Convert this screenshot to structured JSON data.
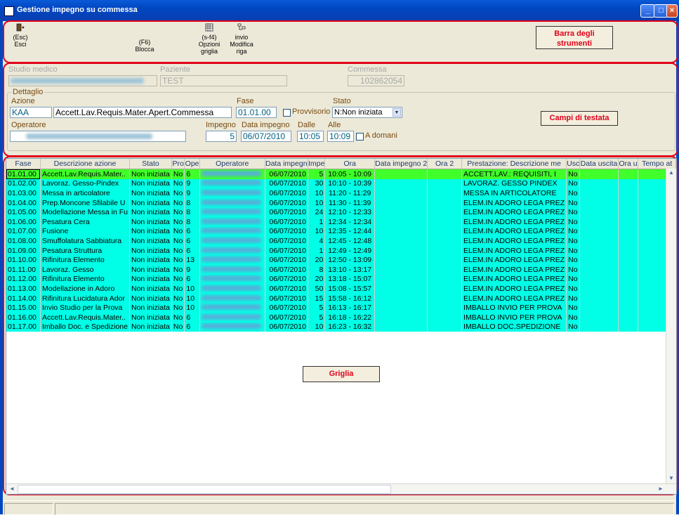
{
  "window": {
    "title": "Gestione impegno su commessa"
  },
  "toolbar": {
    "buttons": [
      {
        "line1": "(Esc)",
        "line2": "Esci",
        "icon": "exit-door-icon"
      },
      {
        "line1": "(F6)",
        "line2": "Blocca"
      },
      {
        "line1": "(s-f4)",
        "line2": "Opzioni",
        "line3": "griglia",
        "icon": "grid-options-icon"
      },
      {
        "line1": "invio",
        "line2": "Modifica",
        "line3": "riga",
        "icon": "edit-row-icon"
      }
    ]
  },
  "callouts": {
    "toolbar": "Barra degli strumenti",
    "header": "Campi di testata",
    "grid": "Griglia"
  },
  "header": {
    "studio_label": "Studio medico",
    "paziente_label": "Paziente",
    "paziente_value": "TEST",
    "commessa_label": "Commessa",
    "commessa_value": "102862054",
    "dettaglio_label": "Dettaglio",
    "azione_label": "Azione",
    "azione_code": "KAA",
    "azione_desc": "Accett.Lav.Requis.Mater.Apert.Commessa",
    "fase_label": "Fase",
    "fase_value": "01.01.00",
    "provvisorio_label": "Provvisorio",
    "stato_label": "Stato",
    "stato_value": "N:Non iniziata",
    "operatore_label": "Operatore",
    "impegno_label": "Impegno",
    "impegno_value": "5",
    "data_impegno_label": "Data impegno",
    "data_impegno_value": "06/07/2010",
    "dalle_label": "Dalle",
    "dalle_value": "10:05",
    "alle_label": "Alle",
    "alle_value": "10:09",
    "a_domani_label": "A domani"
  },
  "grid": {
    "columns": [
      "Fase",
      "Descrizione azione",
      "Stato",
      "Pro",
      "Ope",
      "Operatore",
      "Data impegn",
      "Impe",
      "Ora",
      "Data impegno 2",
      "Ora 2",
      "Prestazione: Descrizione me",
      "Usc",
      "Data uscita",
      "Ora u",
      "Tempo at"
    ],
    "rows": [
      {
        "fase": "01.01.00",
        "desc": "Accett.Lav.Requis.Mater..",
        "stato": "Non iniziata",
        "pro": "No",
        "ope": "6",
        "data": "06/07/2010",
        "imp": "5",
        "ora": "10:05 - 10:09",
        "prest": "ACCETT.LAV.: REQUISITI, I",
        "usc": "No",
        "color": "green"
      },
      {
        "fase": "01.02.00",
        "desc": "Lavoraz. Gesso-Pindex",
        "stato": "Non iniziata",
        "pro": "No",
        "ope": "9",
        "data": "06/07/2010",
        "imp": "30",
        "ora": "10:10 - 10:39",
        "prest": "LAVORAZ. GESSO PINDEX",
        "usc": "No",
        "color": "cyan"
      },
      {
        "fase": "01.03.00",
        "desc": "Messa in articolatore",
        "stato": "Non iniziata",
        "pro": "No",
        "ope": "9",
        "data": "06/07/2010",
        "imp": "10",
        "ora": "11:20 - 11:29",
        "prest": "MESSA IN ARTICOLATORE",
        "usc": "No",
        "color": "cyan"
      },
      {
        "fase": "01.04.00",
        "desc": "Prep.Moncone Sfilabile U",
        "stato": "Non iniziata",
        "pro": "No",
        "ope": "8",
        "data": "06/07/2010",
        "imp": "10",
        "ora": "11:30 - 11:39",
        "prest": "ELEM.IN ADORO LEGA PREZ",
        "usc": "No",
        "color": "cyan"
      },
      {
        "fase": "01.05.00",
        "desc": "Modellazione Messa in Fu",
        "stato": "Non iniziata",
        "pro": "No",
        "ope": "8",
        "data": "06/07/2010",
        "imp": "24",
        "ora": "12:10 - 12:33",
        "prest": "ELEM.IN ADORO LEGA PREZ",
        "usc": "No",
        "color": "cyan"
      },
      {
        "fase": "01.06.00",
        "desc": "Pesatura Cera",
        "stato": "Non iniziata",
        "pro": "No",
        "ope": "8",
        "data": "06/07/2010",
        "imp": "1",
        "ora": "12:34 - 12:34",
        "prest": "ELEM.IN ADORO LEGA PREZ",
        "usc": "No",
        "color": "cyan"
      },
      {
        "fase": "01.07.00",
        "desc": "Fusione",
        "stato": "Non iniziata",
        "pro": "No",
        "ope": "6",
        "data": "06/07/2010",
        "imp": "10",
        "ora": "12:35 - 12:44",
        "prest": "ELEM.IN ADORO LEGA PREZ",
        "usc": "No",
        "color": "cyan"
      },
      {
        "fase": "01.08.00",
        "desc": "Smuffolatura Sabbiatura",
        "stato": "Non iniziata",
        "pro": "No",
        "ope": "6",
        "data": "06/07/2010",
        "imp": "4",
        "ora": "12:45 - 12:48",
        "prest": "ELEM.IN ADORO LEGA PREZ",
        "usc": "No",
        "color": "cyan"
      },
      {
        "fase": "01.09.00",
        "desc": "Pesatura Struttura",
        "stato": "Non iniziata",
        "pro": "No",
        "ope": "6",
        "data": "06/07/2010",
        "imp": "1",
        "ora": "12:49 - 12:49",
        "prest": "ELEM.IN ADORO LEGA PREZ",
        "usc": "No",
        "color": "cyan"
      },
      {
        "fase": "01.10.00",
        "desc": "Rifinitura Elemento",
        "stato": "Non iniziata",
        "pro": "No",
        "ope": "13",
        "data": "06/07/2010",
        "imp": "20",
        "ora": "12:50 - 13:09",
        "prest": "ELEM.IN ADORO LEGA PREZ",
        "usc": "No",
        "color": "cyan"
      },
      {
        "fase": "01.11.00",
        "desc": "Lavoraz. Gesso",
        "stato": "Non iniziata",
        "pro": "No",
        "ope": "9",
        "data": "06/07/2010",
        "imp": "8",
        "ora": "13:10 - 13:17",
        "prest": "ELEM.IN ADORO LEGA PREZ",
        "usc": "No",
        "color": "cyan"
      },
      {
        "fase": "01.12.00",
        "desc": "Rifinitura Elemento",
        "stato": "Non iniziata",
        "pro": "No",
        "ope": "6",
        "data": "06/07/2010",
        "imp": "20",
        "ora": "13:18 - 15:07",
        "prest": "ELEM.IN ADORO LEGA PREZ",
        "usc": "No",
        "color": "cyan"
      },
      {
        "fase": "01.13.00",
        "desc": "Modellazione in Adoro",
        "stato": "Non iniziata",
        "pro": "No",
        "ope": "10",
        "data": "06/07/2010",
        "imp": "50",
        "ora": "15:08 - 15:57",
        "prest": "ELEM.IN ADORO LEGA PREZ",
        "usc": "No",
        "color": "cyan"
      },
      {
        "fase": "01.14.00",
        "desc": "Rifinitura Lucidatura Ador",
        "stato": "Non iniziata",
        "pro": "No",
        "ope": "10",
        "data": "06/07/2010",
        "imp": "15",
        "ora": "15:58 - 16:12",
        "prest": "ELEM.IN ADORO LEGA PREZ",
        "usc": "No",
        "color": "cyan"
      },
      {
        "fase": "01.15.00",
        "desc": "Invio Studio per la Prova",
        "stato": "Non iniziata",
        "pro": "No",
        "ope": "10",
        "data": "06/07/2010",
        "imp": "5",
        "ora": "16:13 - 16:17",
        "prest": "IMBALLO INVIO PER PROVA",
        "usc": "No",
        "color": "cyan"
      },
      {
        "fase": "01.16.00",
        "desc": "Accett.Lav.Requis.Mater..",
        "stato": "Non iniziata",
        "pro": "No",
        "ope": "6",
        "data": "06/07/2010",
        "imp": "5",
        "ora": "16:18 - 16:22",
        "prest": "IMBALLO INVIO PER PROVA",
        "usc": "No",
        "color": "cyan"
      },
      {
        "fase": "01.17.00",
        "desc": "Imballo Doc. e Spedizione",
        "stato": "Non iniziata",
        "pro": "No",
        "ope": "6",
        "data": "06/07/2010",
        "imp": "10",
        "ora": "16:23 - 16:32",
        "prest": "IMBALLO DOC.SPEDIZIONE",
        "usc": "No",
        "color": "cyan"
      }
    ]
  },
  "colors": {
    "highlight_red": "#e0001a",
    "row_cyan": "#00ffe6",
    "row_green": "#40ff2a"
  }
}
